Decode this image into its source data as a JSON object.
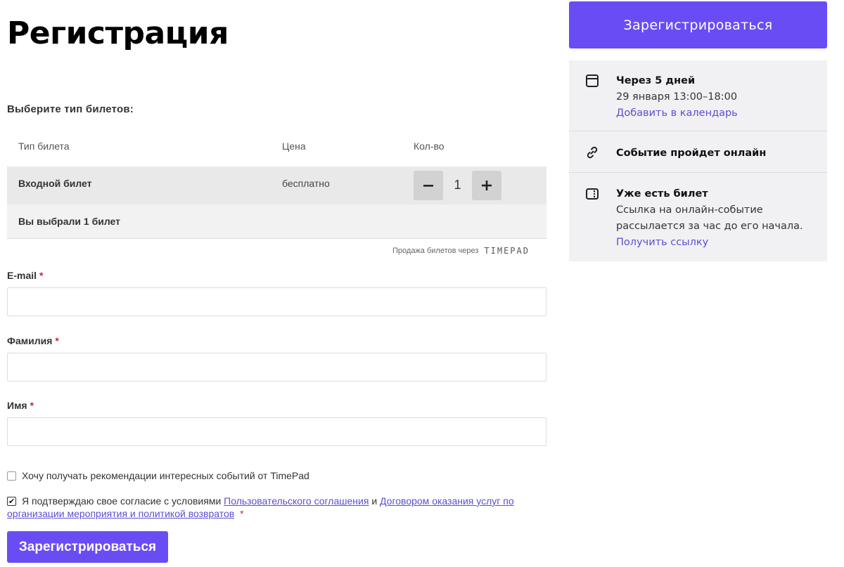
{
  "page": {
    "title": "Регистрация"
  },
  "tickets": {
    "prompt": "Выберите тип билетов:",
    "columns": {
      "type": "Тип билета",
      "price": "Цена",
      "qty": "Кол-во"
    },
    "rows": [
      {
        "name": "Входной билет",
        "price": "бесплатно",
        "quantity": "1"
      }
    ],
    "summary": "Вы выбрали 1 билет",
    "powered_by": "Продажа билетов через",
    "powered_brand": "TIMEPAD"
  },
  "form": {
    "email_label": "E-mail",
    "lastname_label": "Фамилия",
    "firstname_label": "Имя",
    "required_mark": "*",
    "email_value": "",
    "lastname_value": "",
    "firstname_value": "",
    "subscribe_label": "Хочу получать рекомендации интересных событий от TimePad",
    "subscribe_checked": false,
    "consent_prefix": "Я подтверждаю свое согласие с условиями",
    "consent_link1": "Пользовательского соглашения",
    "consent_and": "и",
    "consent_link2": "Договором оказания услуг по организации мероприятия и политикой возвратов",
    "consent_checked": true,
    "submit_label": "Зарегистрироваться"
  },
  "sidebar": {
    "register_button": "Зарегистрироваться",
    "date": {
      "title": "Через 5 дней",
      "time": "29 января 13:00–18:00",
      "link": "Добавить в календарь",
      "icon": "calendar-icon"
    },
    "location": {
      "title": "Событие пройдет онлайн",
      "icon": "link-icon"
    },
    "ticket": {
      "title": "Уже есть билет",
      "line1": "Ссылка на онлайн-событие",
      "line2": "рассылается за час до его начала.",
      "link": "Получить ссылку",
      "icon": "ticket-icon"
    }
  },
  "colors": {
    "accent": "#6a4cf5",
    "link": "#5a4fd1",
    "required": "#d0243a"
  }
}
